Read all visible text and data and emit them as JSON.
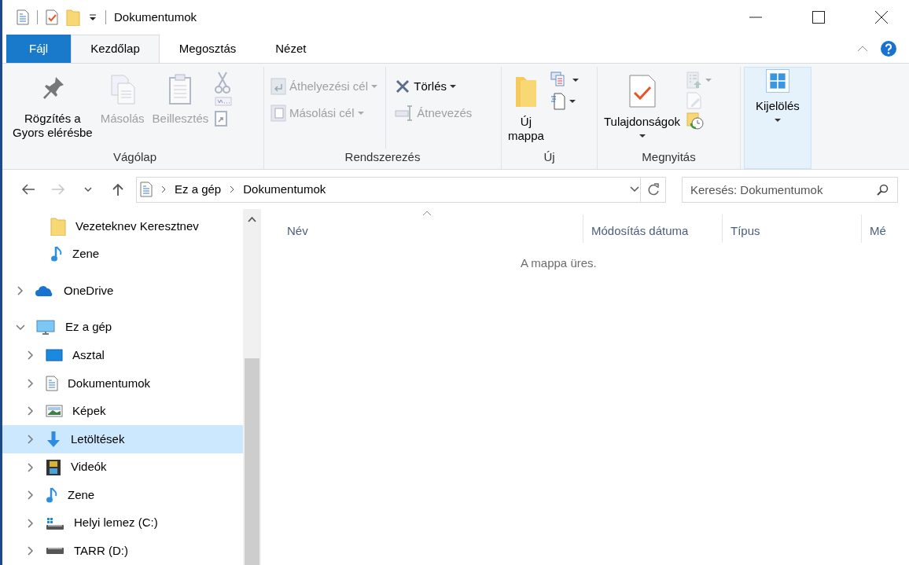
{
  "window": {
    "title": "Dokumentumok"
  },
  "ribbon_tabs": [
    {
      "label": "Fájl",
      "kind": "file",
      "selected": false
    },
    {
      "label": "Kezdőlap",
      "kind": "tab",
      "selected": true
    },
    {
      "label": "Megosztás",
      "kind": "tab",
      "selected": false
    },
    {
      "label": "Nézet",
      "kind": "tab",
      "selected": false
    }
  ],
  "ribbon_groups": [
    {
      "label": "Vágólap",
      "large_buttons": [
        {
          "label": "Rögzítés a\nGyors elérésbe",
          "disabled": false,
          "has_dropdown": false
        },
        {
          "label": "Másolás",
          "disabled": true,
          "has_dropdown": false
        },
        {
          "label": "Beillesztés",
          "disabled": true,
          "has_dropdown": false
        }
      ],
      "small_buttons": [
        {
          "disabled": true
        },
        {
          "disabled": true
        },
        {
          "disabled": true
        }
      ]
    },
    {
      "label": "Rendszerezés",
      "small_buttons": [
        {
          "label": "Áthelyezési cél",
          "disabled": true,
          "has_dropdown": true
        },
        {
          "label": "Másolási cél",
          "disabled": true,
          "has_dropdown": true
        },
        {
          "label": "Törlés",
          "disabled": false,
          "has_dropdown": true
        },
        {
          "label": "Átnevezés",
          "disabled": true,
          "has_dropdown": false
        }
      ]
    },
    {
      "label": "Új",
      "large_buttons": [
        {
          "label": "Új\nmappa",
          "disabled": false,
          "has_dropdown": false
        }
      ],
      "small_buttons": [
        {
          "disabled": false,
          "has_dropdown": true
        },
        {
          "disabled": false,
          "has_dropdown": true
        }
      ]
    },
    {
      "label": "Megnyitás",
      "large_buttons": [
        {
          "label": "Tulajdonságok",
          "disabled": false,
          "has_dropdown": true
        }
      ],
      "small_buttons": [
        {
          "disabled": true,
          "has_dropdown": true
        },
        {
          "disabled": true,
          "has_dropdown": false
        },
        {
          "disabled": false,
          "has_dropdown": false
        }
      ]
    },
    {
      "large_buttons": [
        {
          "label": "Kijelölés",
          "disabled": false,
          "has_dropdown": true,
          "highlighted": true
        }
      ]
    }
  ],
  "address_bar": {
    "back_disabled": false,
    "forward_disabled": true,
    "breadcrumbs": [
      "Ez a gép",
      "Dokumentumok"
    ]
  },
  "search": {
    "placeholder": "Keresés: Dokumentumok"
  },
  "nav_pane": {
    "pinned": [
      {
        "label": "Vezeteknev Keresztnev",
        "selected": false
      },
      {
        "label": "Zene",
        "selected": false
      }
    ],
    "tree": [
      {
        "label": "OneDrive",
        "expanded": false,
        "selected": false
      },
      {
        "label": "Ez a gép",
        "expanded": true,
        "selected": false,
        "children": [
          {
            "label": "Asztal",
            "expanded": false,
            "selected": false
          },
          {
            "label": "Dokumentumok",
            "expanded": false,
            "selected": false
          },
          {
            "label": "Képek",
            "expanded": false,
            "selected": false
          },
          {
            "label": "Letöltések",
            "expanded": false,
            "selected": true
          },
          {
            "label": "Videók",
            "expanded": false,
            "selected": false
          },
          {
            "label": "Zene",
            "expanded": false,
            "selected": false
          },
          {
            "label": "Helyi lemez (C:)",
            "expanded": false,
            "selected": false
          },
          {
            "label": "TARR (D:)",
            "expanded": false,
            "selected": false
          }
        ]
      }
    ]
  },
  "file_list": {
    "columns": [
      {
        "label": "Név",
        "sorted": true
      },
      {
        "label": "Módosítás dátuma",
        "sorted": false
      },
      {
        "label": "Típus",
        "sorted": false
      },
      {
        "label": "Mé",
        "sorted": false
      }
    ],
    "empty_message": "A mappa üres."
  }
}
